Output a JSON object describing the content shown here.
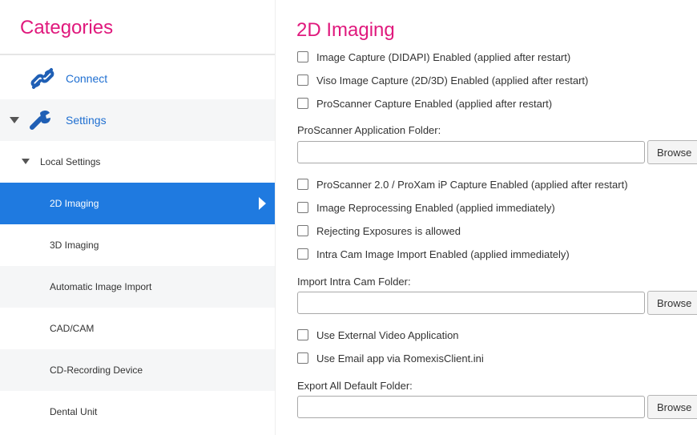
{
  "sidebar": {
    "title": "Categories",
    "items": [
      {
        "label": "Connect",
        "icon": "link-icon"
      },
      {
        "label": "Settings",
        "icon": "wrench-icon"
      },
      {
        "label": "Local Settings"
      },
      {
        "label": "2D Imaging"
      },
      {
        "label": "3D Imaging"
      },
      {
        "label": "Automatic Image Import"
      },
      {
        "label": "CAD/CAM"
      },
      {
        "label": "CD-Recording Device"
      },
      {
        "label": "Dental Unit"
      }
    ]
  },
  "main": {
    "title": "2D Imaging",
    "checkboxes": [
      {
        "label": "Image Capture (DIDAPI) Enabled (applied after restart)",
        "checked": false
      },
      {
        "label": "Viso Image Capture (2D/3D) Enabled (applied after restart)",
        "checked": false
      },
      {
        "label": "ProScanner Capture Enabled (applied after restart)",
        "checked": false
      },
      {
        "label": "ProScanner 2.0 / ProXam iP Capture Enabled (applied after restart)",
        "checked": false
      },
      {
        "label": "Image Reprocessing Enabled (applied immediately)",
        "checked": false
      },
      {
        "label": "Rejecting Exposures is allowed",
        "checked": false
      },
      {
        "label": "Intra Cam Image Import Enabled (applied immediately)",
        "checked": false
      },
      {
        "label": "Use External Video Application",
        "checked": false
      },
      {
        "label": "Use Email app via RomexisClient.ini",
        "checked": false
      }
    ],
    "fields": [
      {
        "label": "ProScanner Application Folder:",
        "value": "",
        "button": "Browse"
      },
      {
        "label": "Import Intra Cam Folder:",
        "value": "",
        "button": "Browse"
      },
      {
        "label": "Export All Default Folder:",
        "value": "",
        "button": "Browse"
      }
    ]
  },
  "colors": {
    "title_accent": "#e0197d",
    "selected_row": "#1f7ae0",
    "link_blue": "#1f6fd1"
  }
}
